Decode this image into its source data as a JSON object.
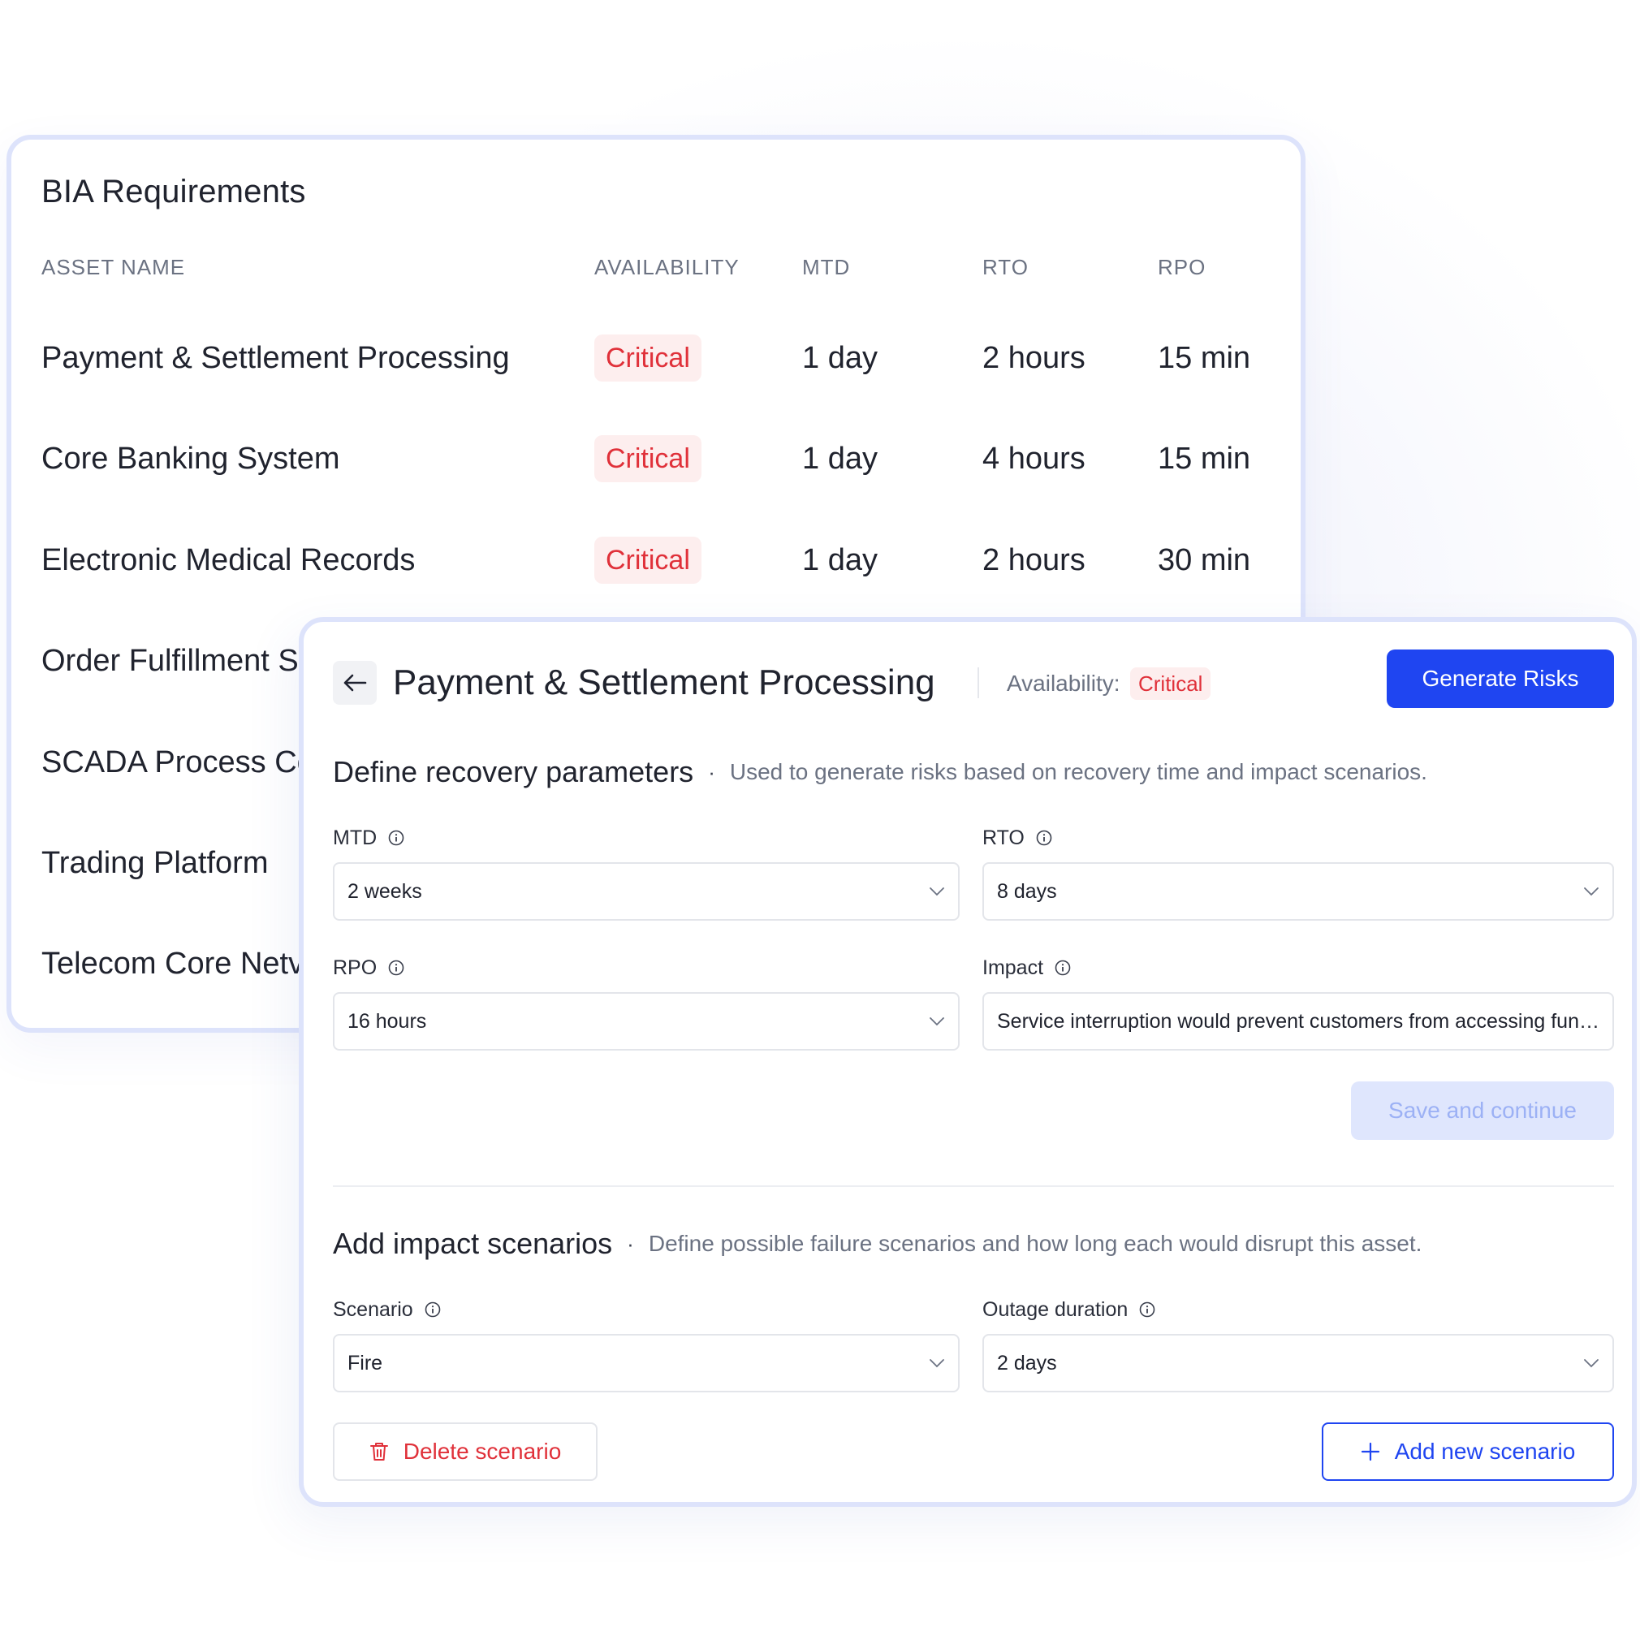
{
  "bia": {
    "title": "BIA Requirements",
    "columns": {
      "asset_name": "ASSET NAME",
      "availability": "AVAILABILITY",
      "mtd": "MTD",
      "rto": "RTO",
      "rpo": "RPO"
    },
    "rows": [
      {
        "name": "Payment & Settlement Processing",
        "availability": "Critical",
        "mtd": "1 day",
        "rto": "2 hours",
        "rpo": "15 min"
      },
      {
        "name": "Core Banking System",
        "availability": "Critical",
        "mtd": "1 day",
        "rto": "4 hours",
        "rpo": "15 min"
      },
      {
        "name": "Electronic Medical Records",
        "availability": "Critical",
        "mtd": "1 day",
        "rto": "2 hours",
        "rpo": "30 min"
      },
      {
        "name": "Order Fulfillment S",
        "availability": "",
        "mtd": "",
        "rto": "",
        "rpo": ""
      },
      {
        "name": "SCADA Process Co",
        "availability": "",
        "mtd": "",
        "rto": "",
        "rpo": ""
      },
      {
        "name": "Trading Platform",
        "availability": "",
        "mtd": "",
        "rto": "",
        "rpo": ""
      },
      {
        "name": "Telecom Core Netv",
        "availability": "",
        "mtd": "",
        "rto": "",
        "rpo": ""
      }
    ]
  },
  "detail": {
    "title": "Payment & Settlement Processing",
    "availability_label": "Availability:",
    "availability_value": "Critical",
    "generate_button": "Generate Risks",
    "recovery": {
      "title": "Define recovery parameters",
      "separator": "·",
      "description": "Used to generate risks based on recovery time and impact scenarios.",
      "mtd_label": "MTD",
      "mtd_value": "2 weeks",
      "rto_label": "RTO",
      "rto_value": "8 days",
      "rpo_label": "RPO",
      "rpo_value": "16 hours",
      "impact_label": "Impact",
      "impact_value": "Service interruption would prevent customers from accessing funds and completing payments",
      "save_button": "Save and continue"
    },
    "scenarios": {
      "title": "Add impact scenarios",
      "separator": "·",
      "description": "Define possible failure scenarios and how long each would disrupt this asset.",
      "scenario_label": "Scenario",
      "scenario_value": "Fire",
      "duration_label": "Outage duration",
      "duration_value": "2 days",
      "delete_button": "Delete scenario",
      "add_button": "Add new scenario"
    }
  },
  "colors": {
    "primary": "#1f45f1",
    "critical": "#e0313a",
    "critical_bg": "#fdeeee",
    "card_border": "#dde3fb",
    "disabled_bg": "#dfe6fd"
  },
  "icons": {
    "back": "arrow-left-icon",
    "info": "info-icon",
    "dropdown": "chevron-down-icon",
    "delete": "trash-icon",
    "add": "plus-icon"
  }
}
